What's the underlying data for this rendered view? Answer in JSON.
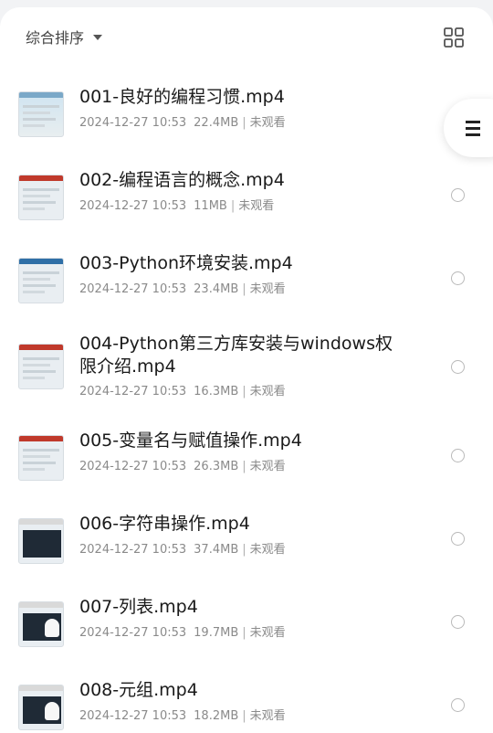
{
  "header": {
    "sort_label": "综合排序"
  },
  "files": [
    {
      "name": "001-良好的编程习惯.mp4",
      "date": "2024-12-27 10:53",
      "size": "22.4MB",
      "status": "未观看",
      "thumb": "scene"
    },
    {
      "name": "002-编程语言的概念.mp4",
      "date": "2024-12-27 10:53",
      "size": "11MB",
      "status": "未观看",
      "thumb": "doc-red"
    },
    {
      "name": "003-Python环境安装.mp4",
      "date": "2024-12-27 10:53",
      "size": "23.4MB",
      "status": "未观看",
      "thumb": "doc-blue"
    },
    {
      "name": "004-Python第三方库安装与windows权限介绍.mp4",
      "date": "2024-12-27 10:53",
      "size": "16.3MB",
      "status": "未观看",
      "thumb": "doc-red"
    },
    {
      "name": "005-变量名与赋值操作.mp4",
      "date": "2024-12-27 10:53",
      "size": "26.3MB",
      "status": "未观看",
      "thumb": "doc-red"
    },
    {
      "name": "006-字符串操作.mp4",
      "date": "2024-12-27 10:53",
      "size": "37.4MB",
      "status": "未观看",
      "thumb": "code"
    },
    {
      "name": "007-列表.mp4",
      "date": "2024-12-27 10:53",
      "size": "19.7MB",
      "status": "未观看",
      "thumb": "code-face"
    },
    {
      "name": "008-元组.mp4",
      "date": "2024-12-27 10:53",
      "size": "18.2MB",
      "status": "未观看",
      "thumb": "code-face"
    }
  ],
  "colors": {
    "title": "#1a1a1a",
    "meta": "#8a8a8a",
    "accent_red": "#c0392b",
    "accent_blue": "#2f6fa7"
  }
}
